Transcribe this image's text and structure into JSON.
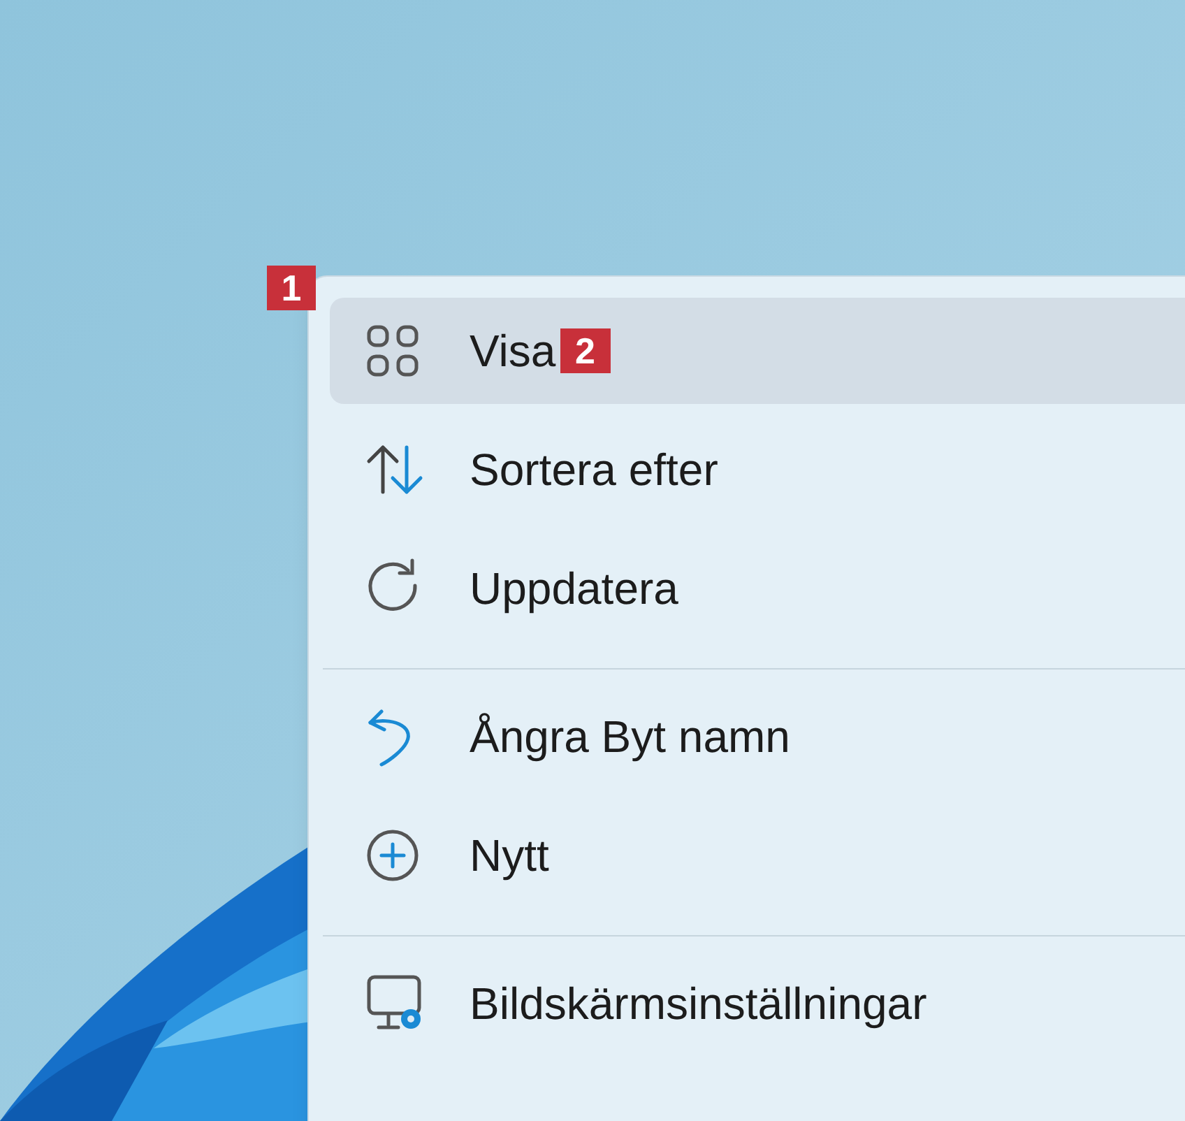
{
  "menu_marker": "1",
  "menu": [
    {
      "kind": "item",
      "label": "Visa",
      "selected": true,
      "marker": "2"
    },
    {
      "kind": "item",
      "label": "Sortera efter",
      "selected": false
    },
    {
      "kind": "item",
      "label": "Uppdatera",
      "selected": false
    },
    {
      "kind": "separator"
    },
    {
      "kind": "item",
      "label": "Ångra Byt namn",
      "selected": false
    },
    {
      "kind": "item",
      "label": "Nytt",
      "selected": false
    },
    {
      "kind": "separator"
    },
    {
      "kind": "item",
      "label": "Bildskärmsinställningar",
      "selected": false
    }
  ]
}
